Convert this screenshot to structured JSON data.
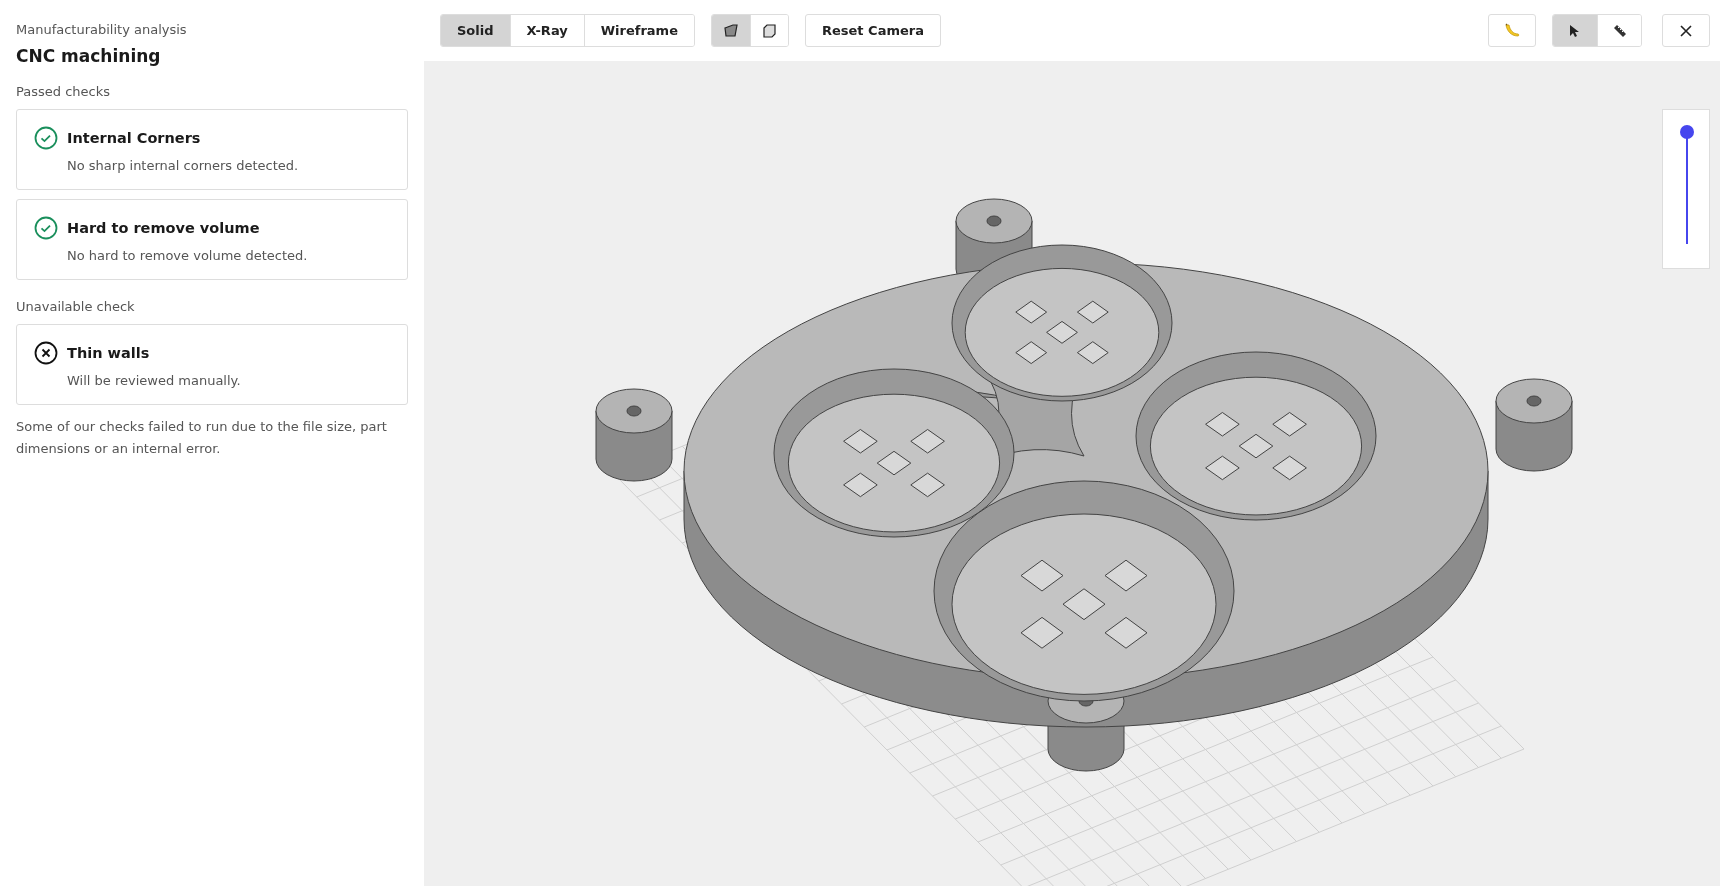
{
  "header": {
    "subtitle": "Manufacturability analysis",
    "title": "CNC machining"
  },
  "sections": [
    {
      "heading": "Passed checks",
      "checks": [
        {
          "kind": "passed",
          "title": "Internal Corners",
          "description": "No sharp internal corners detected."
        },
        {
          "kind": "passed",
          "title": "Hard to remove volume",
          "description": "No hard to remove volume detected."
        }
      ]
    },
    {
      "heading": "Unavailable check",
      "checks": [
        {
          "kind": "unavailable",
          "title": "Thin walls",
          "description": "Will be reviewed manually."
        }
      ]
    }
  ],
  "note": "Some of our checks failed to run due to the file size, part dimensions or an internal error.",
  "toolbar": {
    "view_modes": [
      {
        "label": "Solid",
        "selected": true
      },
      {
        "label": "X-Ray",
        "selected": false
      },
      {
        "label": "Wireframe",
        "selected": false
      }
    ],
    "projections": [
      {
        "kind": "perspective",
        "selected": true
      },
      {
        "kind": "orthographic",
        "selected": false
      }
    ],
    "reset_camera": "Reset Camera",
    "tools": [
      {
        "kind": "select",
        "selected": true
      },
      {
        "kind": "measure",
        "selected": false
      }
    ]
  },
  "slider": {
    "level": 1
  }
}
